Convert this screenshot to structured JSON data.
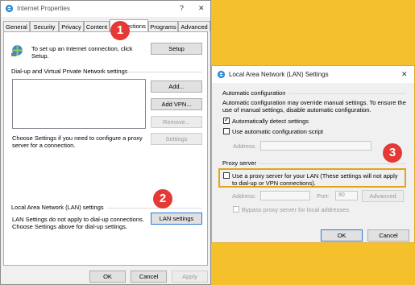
{
  "ie": {
    "title": "Internet Properties",
    "help": "?",
    "close": "✕",
    "tabs": [
      "General",
      "Security",
      "Privacy",
      "Content",
      "Connections",
      "Programs",
      "Advanced"
    ],
    "active_tab": "Connections",
    "setup_text": "To set up an Internet connection, click Setup.",
    "setup_btn": "Setup",
    "dialup_header": "Dial-up and Virtual Private Network settings",
    "add_btn": "Add...",
    "add_vpn_btn": "Add VPN...",
    "remove_btn": "Remove...",
    "settings_btn": "Settings",
    "proxy_text": "Choose Settings if you need to configure a proxy server for a connection.",
    "lan_header": "Local Area Network (LAN) settings",
    "lan_text": "LAN Settings do not apply to dial-up connections. Choose Settings above for dial-up settings.",
    "lan_btn": "LAN settings",
    "ok": "OK",
    "cancel": "Cancel",
    "apply": "Apply"
  },
  "lan": {
    "title": "Local Area Network (LAN) Settings",
    "close": "✕",
    "auto_header": "Automatic configuration",
    "auto_text": "Automatic configuration may override manual settings. To ensure the use of manual settings, disable automatic configuration.",
    "auto_detect": "Automatically detect settings",
    "auto_detect_checked": true,
    "use_script": "Use automatic configuration script",
    "address_label": "Address",
    "proxy_header": "Proxy server",
    "use_proxy": "Use a proxy server for your LAN (These settings will not apply to dial-up or VPN connections).",
    "addr_label": "Address:",
    "port_label": "Port:",
    "port_value": "80",
    "advanced": "Advanced",
    "bypass": "Bypass proxy server for local addresses",
    "ok": "OK",
    "cancel": "Cancel"
  },
  "badges": [
    "1",
    "2",
    "3"
  ],
  "colors": {
    "background": "#f4c12c",
    "badge": "#e53935",
    "highlight": "#e2a31e"
  }
}
